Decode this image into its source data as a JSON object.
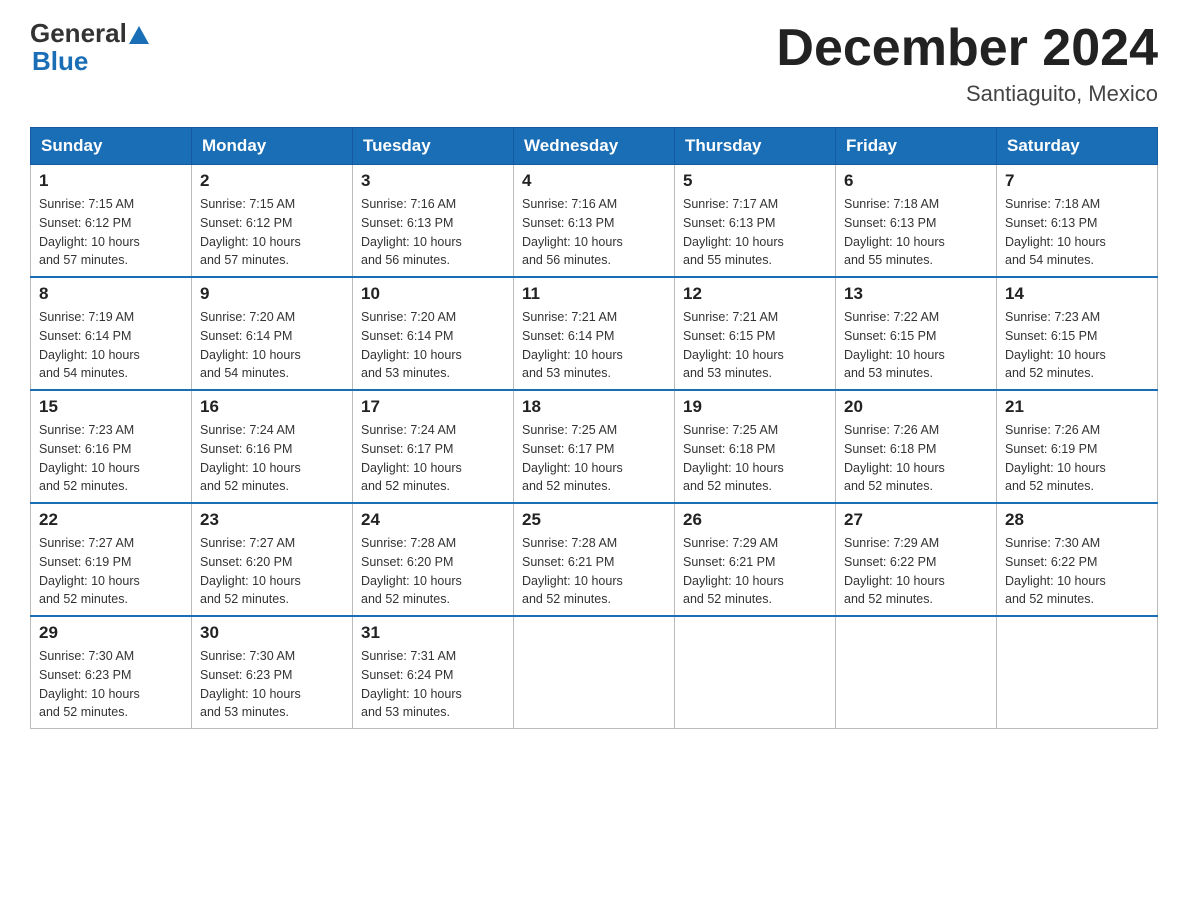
{
  "header": {
    "logo_general": "General",
    "logo_blue": "Blue",
    "month_title": "December 2024",
    "location": "Santiaguito, Mexico"
  },
  "weekdays": [
    "Sunday",
    "Monday",
    "Tuesday",
    "Wednesday",
    "Thursday",
    "Friday",
    "Saturday"
  ],
  "weeks": [
    [
      {
        "day": "1",
        "sunrise": "7:15 AM",
        "sunset": "6:12 PM",
        "daylight": "10 hours and 57 minutes."
      },
      {
        "day": "2",
        "sunrise": "7:15 AM",
        "sunset": "6:12 PM",
        "daylight": "10 hours and 57 minutes."
      },
      {
        "day": "3",
        "sunrise": "7:16 AM",
        "sunset": "6:13 PM",
        "daylight": "10 hours and 56 minutes."
      },
      {
        "day": "4",
        "sunrise": "7:16 AM",
        "sunset": "6:13 PM",
        "daylight": "10 hours and 56 minutes."
      },
      {
        "day": "5",
        "sunrise": "7:17 AM",
        "sunset": "6:13 PM",
        "daylight": "10 hours and 55 minutes."
      },
      {
        "day": "6",
        "sunrise": "7:18 AM",
        "sunset": "6:13 PM",
        "daylight": "10 hours and 55 minutes."
      },
      {
        "day": "7",
        "sunrise": "7:18 AM",
        "sunset": "6:13 PM",
        "daylight": "10 hours and 54 minutes."
      }
    ],
    [
      {
        "day": "8",
        "sunrise": "7:19 AM",
        "sunset": "6:14 PM",
        "daylight": "10 hours and 54 minutes."
      },
      {
        "day": "9",
        "sunrise": "7:20 AM",
        "sunset": "6:14 PM",
        "daylight": "10 hours and 54 minutes."
      },
      {
        "day": "10",
        "sunrise": "7:20 AM",
        "sunset": "6:14 PM",
        "daylight": "10 hours and 53 minutes."
      },
      {
        "day": "11",
        "sunrise": "7:21 AM",
        "sunset": "6:14 PM",
        "daylight": "10 hours and 53 minutes."
      },
      {
        "day": "12",
        "sunrise": "7:21 AM",
        "sunset": "6:15 PM",
        "daylight": "10 hours and 53 minutes."
      },
      {
        "day": "13",
        "sunrise": "7:22 AM",
        "sunset": "6:15 PM",
        "daylight": "10 hours and 53 minutes."
      },
      {
        "day": "14",
        "sunrise": "7:23 AM",
        "sunset": "6:15 PM",
        "daylight": "10 hours and 52 minutes."
      }
    ],
    [
      {
        "day": "15",
        "sunrise": "7:23 AM",
        "sunset": "6:16 PM",
        "daylight": "10 hours and 52 minutes."
      },
      {
        "day": "16",
        "sunrise": "7:24 AM",
        "sunset": "6:16 PM",
        "daylight": "10 hours and 52 minutes."
      },
      {
        "day": "17",
        "sunrise": "7:24 AM",
        "sunset": "6:17 PM",
        "daylight": "10 hours and 52 minutes."
      },
      {
        "day": "18",
        "sunrise": "7:25 AM",
        "sunset": "6:17 PM",
        "daylight": "10 hours and 52 minutes."
      },
      {
        "day": "19",
        "sunrise": "7:25 AM",
        "sunset": "6:18 PM",
        "daylight": "10 hours and 52 minutes."
      },
      {
        "day": "20",
        "sunrise": "7:26 AM",
        "sunset": "6:18 PM",
        "daylight": "10 hours and 52 minutes."
      },
      {
        "day": "21",
        "sunrise": "7:26 AM",
        "sunset": "6:19 PM",
        "daylight": "10 hours and 52 minutes."
      }
    ],
    [
      {
        "day": "22",
        "sunrise": "7:27 AM",
        "sunset": "6:19 PM",
        "daylight": "10 hours and 52 minutes."
      },
      {
        "day": "23",
        "sunrise": "7:27 AM",
        "sunset": "6:20 PM",
        "daylight": "10 hours and 52 minutes."
      },
      {
        "day": "24",
        "sunrise": "7:28 AM",
        "sunset": "6:20 PM",
        "daylight": "10 hours and 52 minutes."
      },
      {
        "day": "25",
        "sunrise": "7:28 AM",
        "sunset": "6:21 PM",
        "daylight": "10 hours and 52 minutes."
      },
      {
        "day": "26",
        "sunrise": "7:29 AM",
        "sunset": "6:21 PM",
        "daylight": "10 hours and 52 minutes."
      },
      {
        "day": "27",
        "sunrise": "7:29 AM",
        "sunset": "6:22 PM",
        "daylight": "10 hours and 52 minutes."
      },
      {
        "day": "28",
        "sunrise": "7:30 AM",
        "sunset": "6:22 PM",
        "daylight": "10 hours and 52 minutes."
      }
    ],
    [
      {
        "day": "29",
        "sunrise": "7:30 AM",
        "sunset": "6:23 PM",
        "daylight": "10 hours and 52 minutes."
      },
      {
        "day": "30",
        "sunrise": "7:30 AM",
        "sunset": "6:23 PM",
        "daylight": "10 hours and 53 minutes."
      },
      {
        "day": "31",
        "sunrise": "7:31 AM",
        "sunset": "6:24 PM",
        "daylight": "10 hours and 53 minutes."
      },
      null,
      null,
      null,
      null
    ]
  ],
  "labels": {
    "sunrise": "Sunrise:",
    "sunset": "Sunset:",
    "daylight": "Daylight:"
  }
}
